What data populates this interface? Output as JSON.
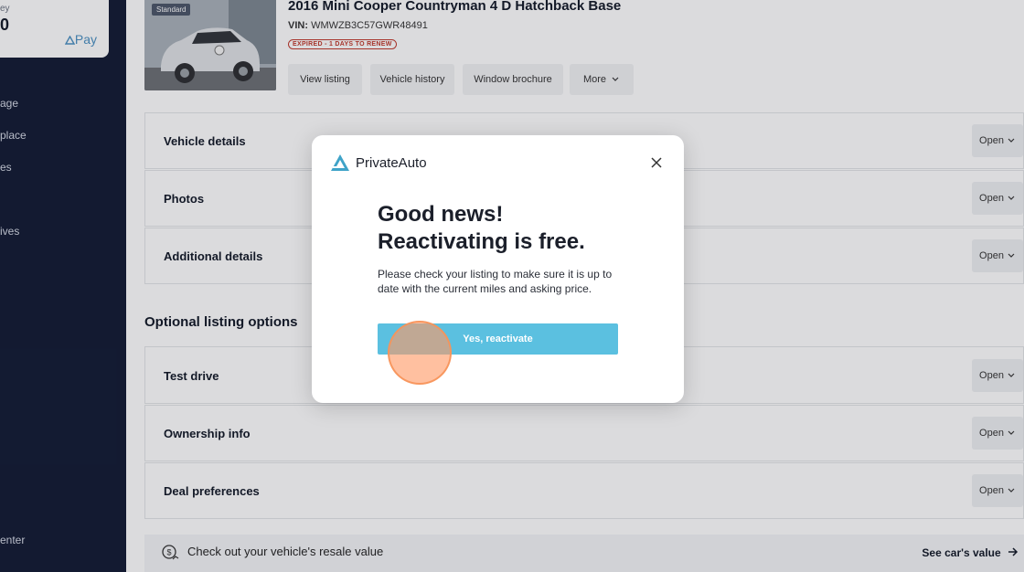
{
  "sidebar": {
    "wallet_label": "ey",
    "wallet_amount": "0",
    "pay_label": "Pay",
    "nav_items": [
      "age",
      "place",
      "es",
      "ives"
    ],
    "bottom_item": "enter"
  },
  "listing": {
    "badge": "Standard",
    "title": "2016 Mini Cooper Countryman 4 D Hatchback Base",
    "vin_label": "VIN:",
    "vin_value": "WMWZB3C57GWR48491",
    "status": "EXPIRED - 1 DAYS TO RENEW",
    "actions": [
      "View listing",
      "Vehicle history",
      "Window brochure",
      "More"
    ]
  },
  "sections": [
    "Vehicle details",
    "Photos",
    "Additional details"
  ],
  "optional_heading": "Optional listing options",
  "optional_sections": [
    "Test drive",
    "Ownership info",
    "Deal preferences"
  ],
  "open_label": "Open",
  "resale": {
    "text": "Check out your vehicle's resale value",
    "link": "See car's value"
  },
  "modal": {
    "brand": "PrivateAuto",
    "title_line1": "Good news!",
    "title_line2": "Reactivating is free.",
    "body": "Please check your listing to make sure it is up to date with the current miles and asking price.",
    "button": "Yes, reactivate"
  },
  "colors": {
    "sidebar": "#111a33",
    "accent": "#5bc0e0",
    "expired": "#c0392b",
    "brand_teal": "#3fa3c8"
  }
}
